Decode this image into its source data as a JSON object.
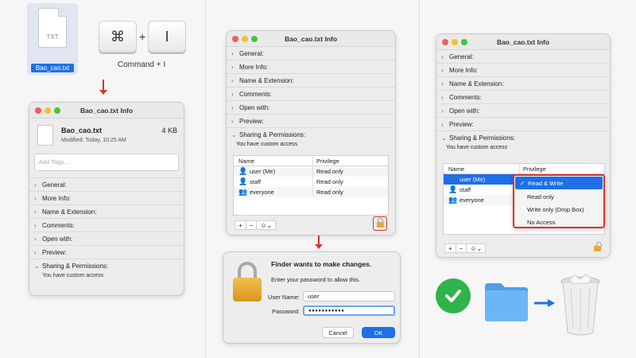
{
  "step1": {
    "file_icon_label": "TXT",
    "file_name": "Bao_cao.txt",
    "shortcut_key1": "⌘",
    "shortcut_plus": "+",
    "shortcut_key2": "I",
    "shortcut_caption": "Command + I"
  },
  "info_window_small": {
    "title": "Bao_cao.txt Info",
    "file_name": "Bao_cao.txt",
    "file_size": "4 KB",
    "modified": "Modified: Today, 10:25 AM",
    "tags_placeholder": "Add Tags...",
    "sections": [
      "General:",
      "More Info:",
      "Name & Extension:",
      "Comments:",
      "Open with:",
      "Preview:",
      "Sharing & Permissions:"
    ],
    "access_text": "You have custom access"
  },
  "info_window_middle": {
    "title": "Bao_cao.txt Info",
    "sections": [
      "General:",
      "More Info:",
      "Name & Extension:",
      "Comments:",
      "Open with:",
      "Preview:",
      "Sharing & Permissions:"
    ],
    "access_text": "You have custom access",
    "col_name": "Name",
    "col_privilege": "Privilege",
    "rows": [
      {
        "name": "user (Me)",
        "privilege": "Read only"
      },
      {
        "name": "staff",
        "privilege": "Read only"
      },
      {
        "name": "everyone",
        "privilege": "Read only"
      }
    ],
    "btn_add": "+",
    "btn_remove": "−",
    "btn_action": "☺⌄"
  },
  "auth_dialog": {
    "title": "Finder wants to make changes.",
    "subtitle": "Enter your password to allow this.",
    "username_label": "User Name:",
    "username_value": "user",
    "password_label": "Password:",
    "password_value": "●●●●●●●●●●●",
    "cancel_label": "Cancel",
    "ok_label": "OK"
  },
  "info_window_right": {
    "title": "Bao_cao.txt Info",
    "sections": [
      "General:",
      "More Info:",
      "Name & Extension:",
      "Comments:",
      "Open with:",
      "Preview:",
      "Sharing & Permissions:"
    ],
    "access_text": "You have custom access",
    "col_name": "Name",
    "col_privilege": "Privilege",
    "rows": [
      {
        "name": "user (Me)"
      },
      {
        "name": "staff"
      },
      {
        "name": "everyone"
      }
    ],
    "menu_options": [
      "Read & Write",
      "Read only",
      "Write only (Drop Box)",
      "No Access"
    ],
    "menu_selected": "Read & Write",
    "btn_add": "+",
    "btn_remove": "−",
    "btn_action": "☺⌄"
  },
  "colors": {
    "accent_blue": "#1e6fe8",
    "highlight_red": "#d9342b",
    "check_green": "#2fb34a",
    "folder_blue": "#5aaaf0"
  }
}
